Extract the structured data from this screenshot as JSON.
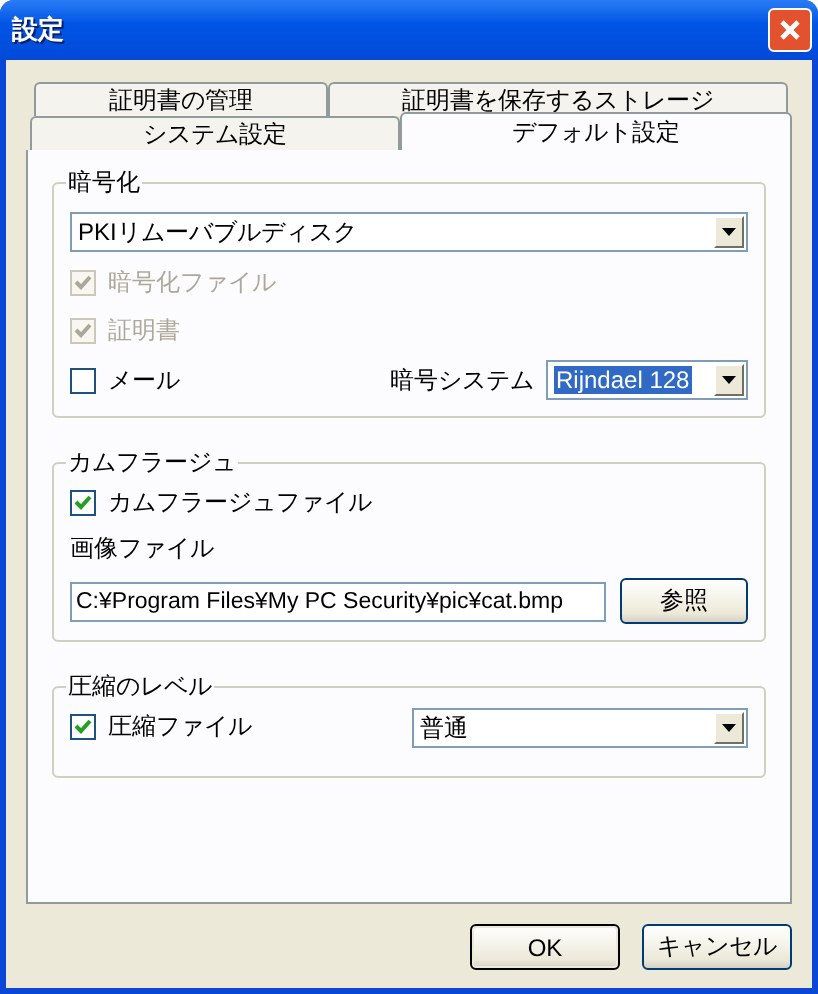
{
  "window": {
    "title": "設定"
  },
  "tab_rows": [
    {
      "tabs": [
        {
          "label": "証明書の管理",
          "selected": false
        },
        {
          "label": "証明書を保存するストレージ",
          "selected": false
        }
      ]
    },
    {
      "tabs": [
        {
          "label": "システム設定",
          "selected": false
        },
        {
          "label": "デフォルト設定",
          "selected": true
        }
      ]
    }
  ],
  "encryption": {
    "title": "暗号化",
    "device": {
      "value": "PKIリムーバブルディスク"
    },
    "options": [
      {
        "label": "暗号化ファイル",
        "checked": true,
        "disabled": true
      },
      {
        "label": "証明書",
        "checked": true,
        "disabled": true
      },
      {
        "label": "メール",
        "checked": false,
        "disabled": false
      }
    ],
    "system": {
      "label": "暗号システム",
      "value": "Rijndael 128",
      "highlighted": true
    }
  },
  "camouflage": {
    "title": "カムフラージュ",
    "option": {
      "label": "カムフラージュファイル",
      "checked": true
    },
    "image": {
      "label": "画像ファイル",
      "value": "C:¥Program Files¥My PC Security¥pic¥cat.bmp",
      "browse": "参照"
    }
  },
  "compression": {
    "title": "圧縮のレベル",
    "option": {
      "label": "圧縮ファイル",
      "checked": true
    },
    "level": {
      "value": "普通"
    }
  },
  "buttons": [
    {
      "label": "OK",
      "default": true
    },
    {
      "label": "キャンセル",
      "default": false
    }
  ]
}
